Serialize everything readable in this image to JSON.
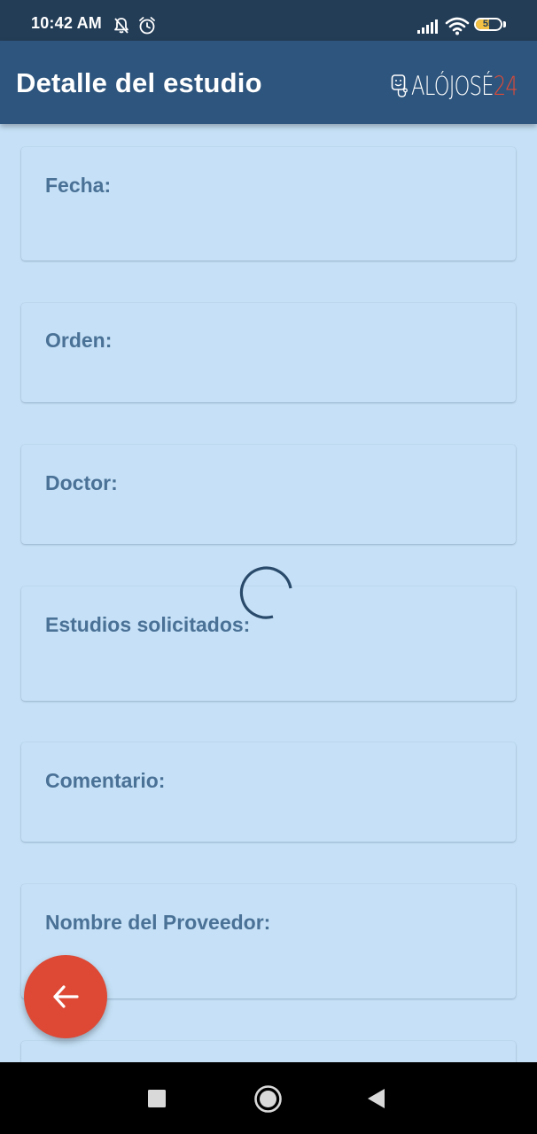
{
  "status_bar": {
    "time": "10:42 AM",
    "battery_level": "55",
    "icons": [
      "notifications-off-icon",
      "alarm-icon",
      "signal-icon",
      "wifi-icon",
      "battery-icon"
    ]
  },
  "app_bar": {
    "title": "Detalle del estudio",
    "brand_name": "ALÓJOSÉ",
    "brand_number": "24",
    "colors": {
      "background": "#2e557d",
      "brand_accent": "#e04a36"
    }
  },
  "fields": [
    {
      "label": "Fecha:"
    },
    {
      "label": "Orden:"
    },
    {
      "label": "Doctor:"
    },
    {
      "label": "Estudios solicitados:"
    },
    {
      "label": "Comentario:"
    },
    {
      "label": "Nombre del Proveedor:"
    }
  ],
  "loading_indicator": "spinner-icon",
  "fab": {
    "icon": "arrow-back-icon",
    "color": "#dd4935"
  },
  "nav_bar": {
    "buttons": [
      "recent-apps-icon",
      "home-icon",
      "back-icon"
    ]
  }
}
